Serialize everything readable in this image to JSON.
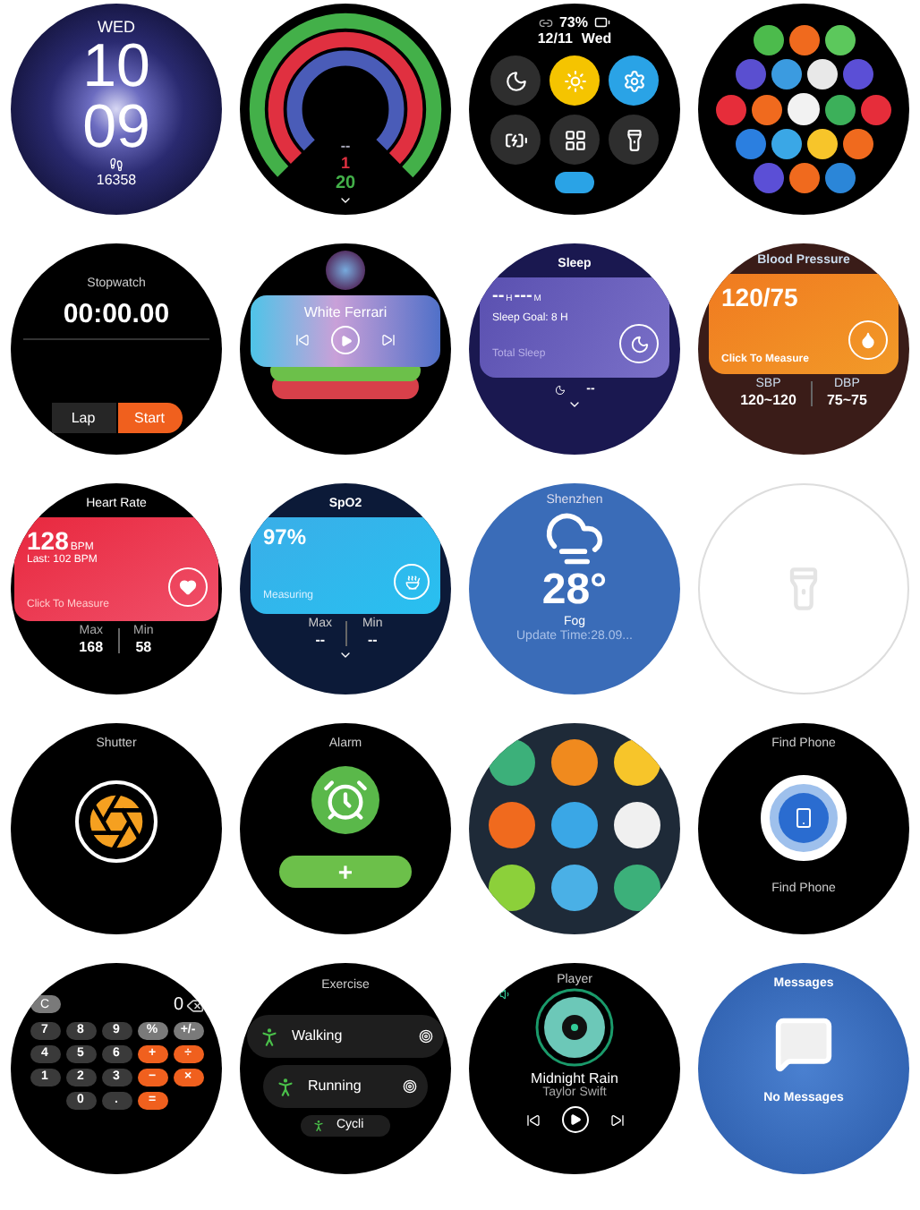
{
  "watches": [
    {
      "kind": "face",
      "day": "WED",
      "hour": "10",
      "minute": "09",
      "steps": "16358"
    },
    {
      "kind": "rings",
      "dash": "--",
      "value_1": "1",
      "value_2": "20"
    },
    {
      "kind": "control",
      "battery": "73%",
      "date": "12/11",
      "weekday": "Wed",
      "tiles": [
        {
          "color": "#2e2e2e"
        },
        {
          "color": "#f5c400"
        },
        {
          "color": "#2aa3e6"
        },
        {
          "color": "#2e2e2e"
        },
        {
          "color": "#2e2e2e"
        },
        {
          "color": "#2e2e2e"
        }
      ]
    },
    {
      "kind": "apps",
      "apps": [
        {
          "color": "#4cbb4c"
        },
        {
          "color": "#f06a1e"
        },
        {
          "color": "#5cc85c"
        },
        {
          "color": "#5a4fd0"
        },
        {
          "color": "#3b9be0"
        },
        {
          "color": "#e8e8e8"
        },
        {
          "color": "#5b4fd6"
        },
        {
          "color": "#e62d3a"
        },
        {
          "color": "#f06a1e"
        },
        {
          "color": "#f2f2f2"
        },
        {
          "color": "#3cb05a"
        },
        {
          "color": "#e62d3a"
        },
        {
          "color": "#2b7fe0"
        },
        {
          "color": "#3aa7e6"
        },
        {
          "color": "#f7c52a"
        },
        {
          "color": "#f06a1e"
        },
        {
          "color": "#5b4fd6"
        },
        {
          "color": "#f06a1e"
        },
        {
          "color": "#2b86d8"
        }
      ]
    },
    {
      "kind": "stopwatch",
      "title": "Stopwatch",
      "time": "00:00.00",
      "buttons": [
        {
          "label": "Lap",
          "selected": false
        },
        {
          "label": "Start",
          "selected": true
        }
      ]
    },
    {
      "kind": "music",
      "song": "White Ferrari"
    },
    {
      "kind": "sleep",
      "title": "Sleep",
      "hours": "--",
      "hours_unit": "H",
      "minutes": "---",
      "minutes_unit": "M",
      "goal": "Sleep Goal:  8 H",
      "total": "Total Sleep",
      "bottom": "--"
    },
    {
      "kind": "pressure",
      "title": "Blood Pressure",
      "value": "120/75",
      "action": "Click To Measure",
      "stats": [
        {
          "label": "SBP",
          "value": "120~120"
        },
        {
          "label": "DBP",
          "value": "75~75"
        }
      ]
    },
    {
      "kind": "heart",
      "title": "Heart Rate",
      "value": "128",
      "unit": "BPM",
      "last": "Last: 102 BPM",
      "action": "Click To Measure",
      "stats": [
        {
          "label": "Max",
          "value": "168"
        },
        {
          "label": "Min",
          "value": "58"
        }
      ]
    },
    {
      "kind": "spo2",
      "title": "SpO2",
      "value": "97%",
      "status": "Measuring",
      "stats": [
        {
          "label": "Max",
          "value": "--"
        },
        {
          "label": "Min",
          "value": "--"
        }
      ]
    },
    {
      "kind": "weather",
      "city": "Shenzhen",
      "temperature": "28°",
      "condition": "Fog",
      "updated": "Update Time:28.09..."
    },
    {
      "kind": "flashlight"
    },
    {
      "kind": "shutter",
      "title": "Shutter"
    },
    {
      "kind": "alarm",
      "title": "Alarm",
      "add": "+"
    },
    {
      "kind": "apps_zoom",
      "apps": [
        {
          "color": "#3cb07a"
        },
        {
          "color": "#f08a1e"
        },
        {
          "color": "#f7c52a"
        },
        {
          "color": "#f06a1e"
        },
        {
          "color": "#3aa7e6"
        },
        {
          "color": "#f0f0f0"
        },
        {
          "color": "#8cd03a"
        },
        {
          "color": "#4ab0e6"
        },
        {
          "color": "#3cb07a"
        }
      ]
    },
    {
      "kind": "findphone",
      "title": "Find Phone",
      "label": "Find Phone"
    },
    {
      "kind": "calculator",
      "display": "0",
      "keys": [
        {
          "label": "C",
          "kind": "fn"
        },
        {
          "label": "7",
          "kind": "digit"
        },
        {
          "label": "8",
          "kind": "digit"
        },
        {
          "label": "9",
          "kind": "digit"
        },
        {
          "label": "%",
          "kind": "fn"
        },
        {
          "label": "+/-",
          "kind": "fn"
        },
        {
          "label": "4",
          "kind": "digit"
        },
        {
          "label": "5",
          "kind": "digit"
        },
        {
          "label": "6",
          "kind": "digit"
        },
        {
          "label": "+",
          "kind": "op"
        },
        {
          "label": "÷",
          "kind": "op"
        },
        {
          "label": "1",
          "kind": "digit"
        },
        {
          "label": "2",
          "kind": "digit"
        },
        {
          "label": "3",
          "kind": "digit"
        },
        {
          "label": "−",
          "kind": "op"
        },
        {
          "label": "×",
          "kind": "op"
        },
        {
          "label": "0",
          "kind": "digit"
        },
        {
          "label": ".",
          "kind": "digit"
        },
        {
          "label": "=",
          "kind": "op"
        }
      ]
    },
    {
      "kind": "exercise",
      "title": "Exercise",
      "items": [
        {
          "label": "Walking"
        },
        {
          "label": "Running"
        },
        {
          "label": "Cycli"
        }
      ]
    },
    {
      "kind": "player",
      "title": "Player",
      "song": "Midnight Rain",
      "artist": "Taylor Swift"
    },
    {
      "kind": "messages",
      "title": "Messages",
      "empty": "No Messages"
    }
  ]
}
